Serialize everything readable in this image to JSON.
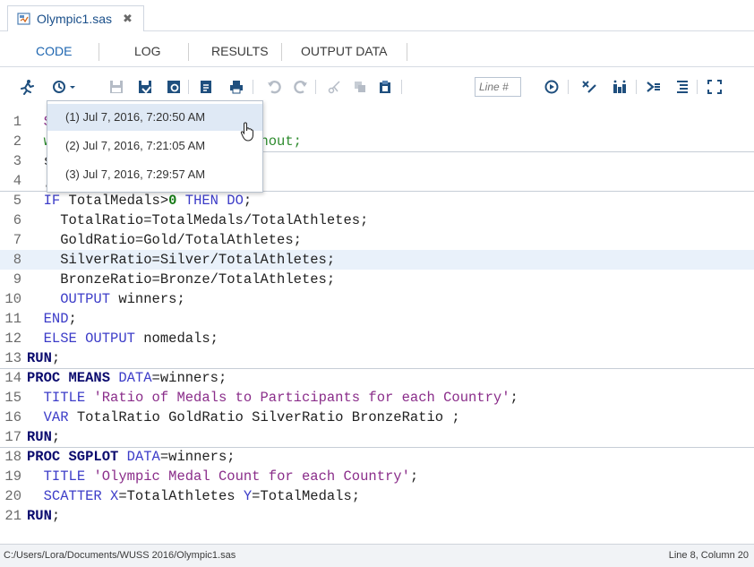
{
  "file_tab": {
    "title": "Olympic1.sas",
    "close": "✖"
  },
  "tabs": [
    "CODE",
    "LOG",
    "RESULTS",
    "OUTPUT DATA"
  ],
  "toolbar": {
    "line_placeholder": "Line #"
  },
  "history_dropdown": [
    "(1)  Jul 7, 2016, 7:20:50 AM",
    "(2)  Jul 7, 2016, 7:21:05 AM",
    "(3)  Jul 7, 2016, 7:29:57 AM"
  ],
  "editor": {
    "selected_line": 8,
    "lines": [
      {
        "n": "1",
        "parts": [
          [
            "txt",
            "  "
          ],
          [
            "str",
            "SAS Files'"
          ],
          [
            "txt",
            ";"
          ]
        ]
      },
      {
        "n": "2",
        "parts": [
          [
            "txt",
            "  "
          ],
          [
            "cmt",
            "with medals from those without;"
          ]
        ]
      },
      {
        "n": "3",
        "parts": [
          [
            "txt",
            "  s;"
          ]
        ]
      },
      {
        "n": "4",
        "parts": [
          [
            "txt",
            "  ;"
          ]
        ]
      },
      {
        "n": "5",
        "parts": [
          [
            "txt",
            "  "
          ],
          [
            "kw",
            "IF"
          ],
          [
            "txt",
            " TotalMedals>"
          ],
          [
            "num",
            "0"
          ],
          [
            "txt",
            " "
          ],
          [
            "kw",
            "THEN DO"
          ],
          [
            "txt",
            ";"
          ]
        ]
      },
      {
        "n": "6",
        "parts": [
          [
            "txt",
            "    TotalRatio=TotalMedals/TotalAthletes;"
          ]
        ]
      },
      {
        "n": "7",
        "parts": [
          [
            "txt",
            "    GoldRatio=Gold/TotalAthletes;"
          ]
        ]
      },
      {
        "n": "8",
        "parts": [
          [
            "txt",
            "    SilverRatio=Silver/TotalAthletes;"
          ]
        ]
      },
      {
        "n": "9",
        "parts": [
          [
            "txt",
            "    BronzeRatio=Bronze/TotalAthletes;"
          ]
        ]
      },
      {
        "n": "10",
        "parts": [
          [
            "txt",
            "    "
          ],
          [
            "kw",
            "OUTPUT"
          ],
          [
            "txt",
            " winners;"
          ]
        ]
      },
      {
        "n": "11",
        "parts": [
          [
            "txt",
            "  "
          ],
          [
            "kw",
            "END"
          ],
          [
            "txt",
            ";"
          ]
        ]
      },
      {
        "n": "12",
        "parts": [
          [
            "txt",
            "  "
          ],
          [
            "kw",
            "ELSE OUTPUT"
          ],
          [
            "txt",
            " nomedals;"
          ]
        ]
      },
      {
        "n": "13",
        "parts": [
          [
            "kwb",
            "RUN"
          ],
          [
            "txt",
            ";"
          ]
        ]
      },
      {
        "n": "14",
        "parts": [
          [
            "kwb",
            "PROC MEANS"
          ],
          [
            "txt",
            " "
          ],
          [
            "kw",
            "DATA"
          ],
          [
            "txt",
            "=winners;"
          ]
        ]
      },
      {
        "n": "15",
        "parts": [
          [
            "txt",
            "  "
          ],
          [
            "kw",
            "TITLE"
          ],
          [
            "txt",
            " "
          ],
          [
            "str",
            "'Ratio of Medals to Participants for each Country'"
          ],
          [
            "txt",
            ";"
          ]
        ]
      },
      {
        "n": "16",
        "parts": [
          [
            "txt",
            "  "
          ],
          [
            "kw",
            "VAR"
          ],
          [
            "txt",
            " TotalRatio GoldRatio SilverRatio BronzeRatio ;"
          ]
        ]
      },
      {
        "n": "17",
        "parts": [
          [
            "kwb",
            "RUN"
          ],
          [
            "txt",
            ";"
          ]
        ]
      },
      {
        "n": "18",
        "parts": [
          [
            "kwb",
            "PROC SGPLOT"
          ],
          [
            "txt",
            " "
          ],
          [
            "kw",
            "DATA"
          ],
          [
            "txt",
            "=winners;"
          ]
        ]
      },
      {
        "n": "19",
        "parts": [
          [
            "txt",
            "  "
          ],
          [
            "kw",
            "TITLE"
          ],
          [
            "txt",
            " "
          ],
          [
            "str",
            "'Olympic Medal Count for each Country'"
          ],
          [
            "txt",
            ";"
          ]
        ]
      },
      {
        "n": "20",
        "parts": [
          [
            "txt",
            "  "
          ],
          [
            "kw",
            "SCATTER X"
          ],
          [
            "txt",
            "=TotalAthletes "
          ],
          [
            "kw",
            "Y"
          ],
          [
            "txt",
            "=TotalMedals;"
          ]
        ]
      },
      {
        "n": "21",
        "parts": [
          [
            "kwb",
            "RUN"
          ],
          [
            "txt",
            ";"
          ]
        ]
      }
    ]
  },
  "status": {
    "path": "C:/Users/Lora/Documents/WUSS 2016/Olympic1.sas",
    "position": "Line 8, Column 20"
  }
}
